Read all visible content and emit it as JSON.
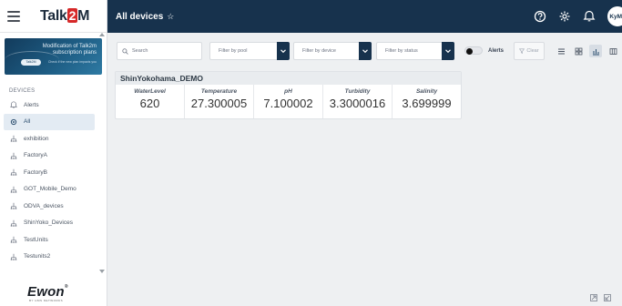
{
  "app": {
    "logo_text": "Talk",
    "logo_number": "2",
    "logo_suffix": "M"
  },
  "banner": {
    "line1": "Modification of Talk2m",
    "line2": "subscription plans",
    "pill": "Talk2M",
    "small": "Check if the new plan impacts you"
  },
  "sidebar": {
    "section_label": "DEVICES",
    "items": [
      {
        "label": "Alerts",
        "icon": "bell-icon",
        "active": false
      },
      {
        "label": "All",
        "icon": "settings-icon",
        "active": true
      },
      {
        "label": "exhibition",
        "icon": "network-icon",
        "active": false
      },
      {
        "label": "FactoryA",
        "icon": "network-icon",
        "active": false
      },
      {
        "label": "FactoryB",
        "icon": "network-icon",
        "active": false
      },
      {
        "label": "GOT_Mobile_Demo",
        "icon": "network-icon",
        "active": false
      },
      {
        "label": "ODVA_devices",
        "icon": "network-icon",
        "active": false
      },
      {
        "label": "ShinYoko_Devices",
        "icon": "network-icon",
        "active": false
      },
      {
        "label": "TestUnits",
        "icon": "network-icon",
        "active": false
      },
      {
        "label": "Testunits2",
        "icon": "network-icon",
        "active": false
      }
    ],
    "brand": "Ewon",
    "brand_sub": "BY HMS NETWORKS"
  },
  "header": {
    "title": "All devices",
    "star": "☆",
    "avatar": "KyMa"
  },
  "toolbar": {
    "search_placeholder": "Search",
    "filter_pool": "Filter by pool",
    "filter_device": "Filter by device",
    "filter_status": "Filter by status",
    "alerts_toggle": "Alerts",
    "clear": "Clear"
  },
  "device": {
    "name": "ShinYokohama_DEMO",
    "metrics": [
      {
        "label": "WaterLevel",
        "value": "620"
      },
      {
        "label": "Temperature",
        "value": "27.300005"
      },
      {
        "label": "pH",
        "value": "7.100002"
      },
      {
        "label": "Turbidity",
        "value": "3.3000016"
      },
      {
        "label": "Salinity",
        "value": "3.699999"
      }
    ]
  },
  "colors": {
    "topbar": "#17324d",
    "active_nav": "#e3ebf3",
    "brand_red": "#d62828"
  }
}
